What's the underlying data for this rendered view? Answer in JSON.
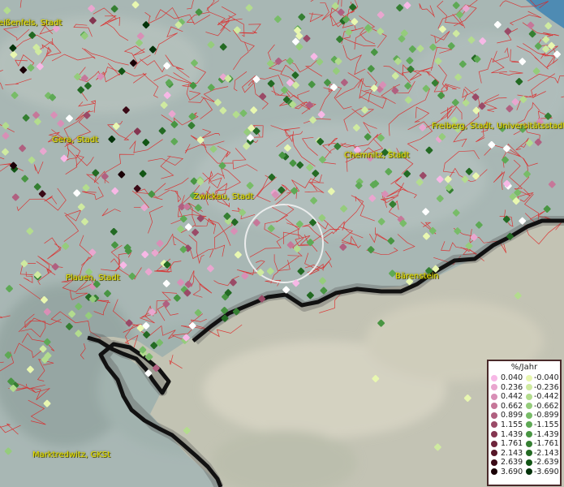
{
  "legend": {
    "title": "%/Jahr",
    "positive": [
      "0.040",
      "0.236",
      "0.442",
      "0.662",
      "0.899",
      "1.155",
      "1.439",
      "1.761",
      "2.143",
      "2.639",
      "3.690"
    ],
    "negative": [
      "-0.040",
      "-0.236",
      "-0.442",
      "-0.662",
      "-0.899",
      "-1.155",
      "-1.439",
      "-1.761",
      "-2.143",
      "-2.639",
      "-3.690"
    ],
    "positive_colors": [
      "#f7b8e6",
      "#e9a6cf",
      "#d88fb6",
      "#c67799",
      "#b06080",
      "#9a4a67",
      "#843550",
      "#6e243b",
      "#561628",
      "#3a0a16",
      "#1a0006"
    ],
    "negative_colors": [
      "#e8f7b0",
      "#cfeaa0",
      "#b3dc8e",
      "#95cc7c",
      "#78bc68",
      "#5ea955",
      "#489542",
      "#357f32",
      "#236a23",
      "#125515",
      "#04320a"
    ]
  },
  "places": [
    {
      "label": "eißenfels, Stadt"
    },
    {
      "label": "Gera, Stadt"
    },
    {
      "label": "Zwickau, Stadt"
    },
    {
      "label": "Chemnitz, Stadt"
    },
    {
      "label": "Freiberg, Stadt, Universitätsstadt"
    },
    {
      "label": "Plauen, Stadt"
    },
    {
      "label": "Bärenstein"
    },
    {
      "label": "Marktredwitz, GKSt"
    }
  ],
  "colors": {
    "boundary": "#e02020",
    "border": "#111111",
    "city_label": "#e7e200"
  }
}
